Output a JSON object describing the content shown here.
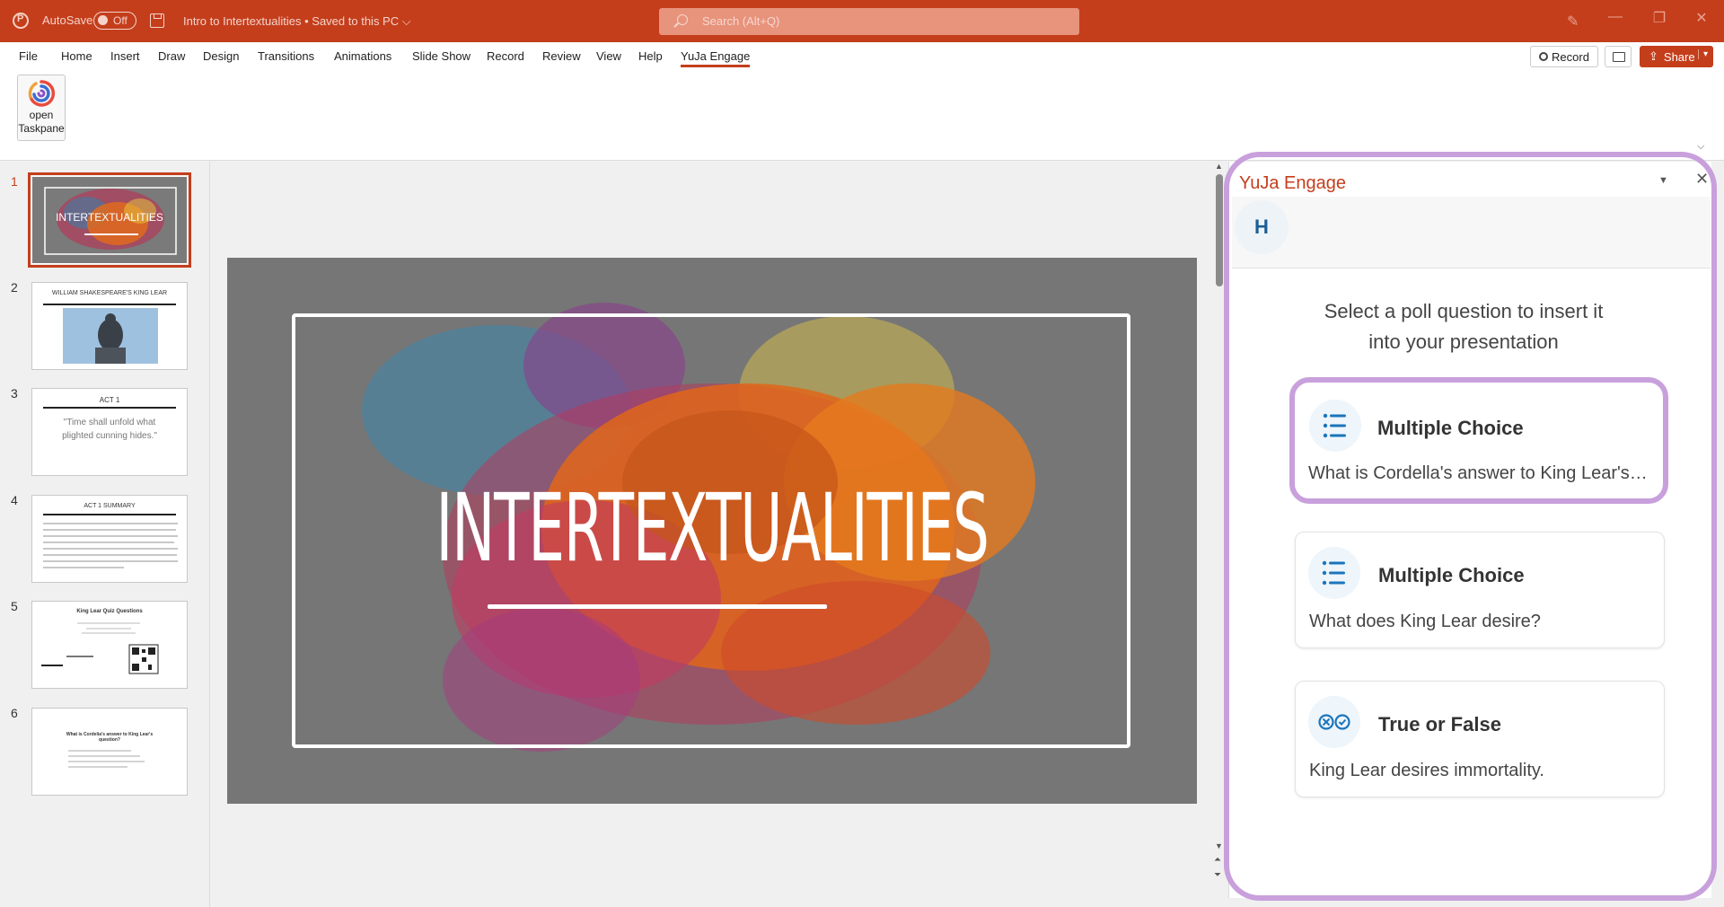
{
  "titlebar": {
    "autosave_label": "AutoSave",
    "autosave_state": "Off",
    "doc_title": "Intro to Intertextualities • Saved to this PC ⌵",
    "search_placeholder": "Search (Alt+Q)"
  },
  "tabs": [
    {
      "label": "File"
    },
    {
      "label": "Home"
    },
    {
      "label": "Insert"
    },
    {
      "label": "Draw"
    },
    {
      "label": "Design"
    },
    {
      "label": "Transitions"
    },
    {
      "label": "Animations"
    },
    {
      "label": "Slide Show"
    },
    {
      "label": "Record"
    },
    {
      "label": "Review"
    },
    {
      "label": "View"
    },
    {
      "label": "Help"
    },
    {
      "label": "YuJa Engage"
    }
  ],
  "actions": {
    "record_label": "Record",
    "share_label": "Share"
  },
  "ribbon": {
    "taskpane_line1": "open",
    "taskpane_line2": "Taskpane"
  },
  "slides": {
    "numbers": [
      "1",
      "2",
      "3",
      "4",
      "5",
      "6"
    ],
    "thumb1_title": "INTERTEXTUALITIES",
    "thumb2_title": "WILLIAM SHAKESPEARE'S KING LEAR",
    "thumb3_title": "ACT 1",
    "thumb3_quote": "\"Time shall unfold what plighted cunning hides.\"",
    "thumb4_title": "ACT 1 SUMMARY",
    "thumb5_title": "King Lear Quiz Questions",
    "thumb6_title": "What is Cordelia's answer to King Lear's question?"
  },
  "slide_main": {
    "title": "INTERTEXTUALITIES"
  },
  "pane": {
    "title": "YuJa Engage",
    "avatar": "H",
    "instruction_line1": "Select a poll question to insert it",
    "instruction_line2": "into your presentation",
    "cards": [
      {
        "type": "Multiple Choice",
        "question": "What is Cordella's answer to King Lear's question?"
      },
      {
        "type": "Multiple Choice",
        "question": "What does King Lear desire?"
      },
      {
        "type": "True or False",
        "question": "King Lear desires immortality."
      }
    ]
  },
  "colors": {
    "accent": "#c43e1c",
    "highlight": "#c8a0dc",
    "icon_blue": "#1b75bb"
  }
}
